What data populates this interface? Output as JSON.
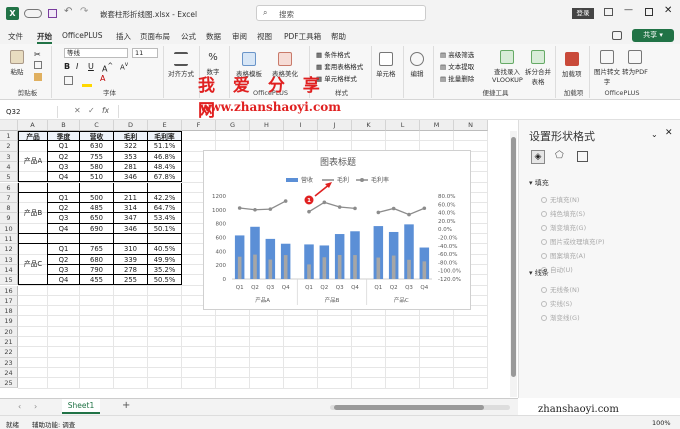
{
  "titlebar": {
    "filename": "嵌套柱形折线图.xlsx",
    "sep": "-",
    "app": "Excel",
    "search_placeholder": "搜索",
    "login": "登录"
  },
  "menu": [
    "文件",
    "开始",
    "OfficePLUS",
    "插入",
    "页面布局",
    "公式",
    "数据",
    "审阅",
    "视图",
    "PDF工具箱",
    "帮助"
  ],
  "share": "共享",
  "ribbon": {
    "paste": "粘贴",
    "clipboard": "剪贴板",
    "font_name": "等线",
    "font_size": "11",
    "font_group": "字体",
    "align": "对齐方式",
    "number": "数字",
    "table_tpl": "表格模板",
    "table_beauty": "表格美化",
    "officeplus": "OfficePLUS",
    "cond": "条件格式",
    "tblfmt": "套用表格格式",
    "cellstyle": "单元格样式",
    "style_group": "样式",
    "cells": "单元格",
    "edit": "编辑",
    "hl": "高级筛选",
    "txt": "文本提取",
    "batch": "批量删除",
    "lookup": "查找录入VLOOKUP",
    "split": "拆分合并表格",
    "util": "便捷工具",
    "addin": "加载项",
    "addin_group": "加载项",
    "pic": "图片转文字",
    "topdf": "转为PDF",
    "offplus2": "OfficePLUS"
  },
  "formula": {
    "namebox": "Q32",
    "fx": "fx"
  },
  "columns": [
    "A",
    "B",
    "C",
    "D",
    "E",
    "F",
    "G",
    "H",
    "I",
    "J",
    "K",
    "L",
    "M",
    "N"
  ],
  "table": {
    "headers": [
      "产品",
      "季度",
      "营收",
      "毛利",
      "毛利率"
    ],
    "groups": [
      {
        "name": "产品A",
        "rows": [
          [
            "Q1",
            "630",
            "322",
            "51.1%"
          ],
          [
            "Q2",
            "755",
            "353",
            "46.8%"
          ],
          [
            "Q3",
            "580",
            "281",
            "48.4%"
          ],
          [
            "Q4",
            "510",
            "346",
            "67.8%"
          ]
        ]
      },
      {
        "name": "产品B",
        "rows": [
          [
            "Q1",
            "500",
            "211",
            "42.2%"
          ],
          [
            "Q2",
            "485",
            "314",
            "64.7%"
          ],
          [
            "Q3",
            "650",
            "347",
            "53.4%"
          ],
          [
            "Q4",
            "690",
            "346",
            "50.1%"
          ]
        ]
      },
      {
        "name": "产品C",
        "rows": [
          [
            "Q1",
            "765",
            "310",
            "40.5%"
          ],
          [
            "Q2",
            "680",
            "339",
            "49.9%"
          ],
          [
            "Q3",
            "790",
            "278",
            "35.2%"
          ],
          [
            "Q4",
            "455",
            "255",
            "50.5%"
          ]
        ]
      }
    ]
  },
  "chart_data": {
    "type": "bar",
    "title": "图表标题",
    "categories": [
      "Q1",
      "Q2",
      "Q3",
      "Q4",
      "Q1",
      "Q2",
      "Q3",
      "Q4",
      "Q1",
      "Q2",
      "Q3",
      "Q4"
    ],
    "groups": [
      "产品A",
      "产品B",
      "产品C"
    ],
    "series": [
      {
        "name": "营收",
        "type": "bar",
        "values": [
          630,
          755,
          580,
          510,
          500,
          485,
          650,
          690,
          765,
          680,
          790,
          455
        ]
      },
      {
        "name": "毛利",
        "type": "bar",
        "values": [
          322,
          353,
          281,
          346,
          211,
          314,
          347,
          346,
          310,
          339,
          278,
          255
        ]
      },
      {
        "name": "毛利率",
        "type": "line",
        "values": [
          51.1,
          46.8,
          48.4,
          67.8,
          42.2,
          64.7,
          53.4,
          50.1,
          40.5,
          49.9,
          35.2,
          50.5
        ]
      }
    ],
    "ylim": [
      0,
      1200
    ],
    "yticks": [
      "0",
      "200",
      "400",
      "600",
      "800",
      "1000",
      "1200"
    ],
    "y2lim": [
      -120,
      80
    ],
    "y2ticks": [
      "80.0%",
      "60.0%",
      "40.0%",
      "20.0%",
      "0.0%",
      "-20.0%",
      "-40.0%",
      "-60.0%",
      "-80.0%",
      "-100.0%",
      "-120.0%"
    ],
    "annotation": "1",
    "colors": {
      "revenue": "#5b8fd6",
      "profit": "#a6a6a6",
      "rate": "#8c8c8c"
    }
  },
  "pane": {
    "title": "设置形状格式",
    "fill": "填充",
    "line": "线条",
    "fill_opts": [
      "无填充(N)",
      "纯色填充(S)",
      "渐变填充(G)",
      "图片或纹理填充(P)",
      "图案填充(A)",
      "自动(U)"
    ],
    "line_opts": [
      "无线条(N)",
      "实线(S)",
      "渐变线(G)"
    ]
  },
  "sheet": {
    "tab": "Sheet1",
    "add": "+"
  },
  "status": {
    "ready": "就绪",
    "access": "辅助功能: 调查",
    "zoom": "100%"
  },
  "watermark": {
    "text": "我 爱 分 享 网",
    "url": "www.zhanshaoyi.com",
    "corner": "zhanshaoyi.com"
  }
}
